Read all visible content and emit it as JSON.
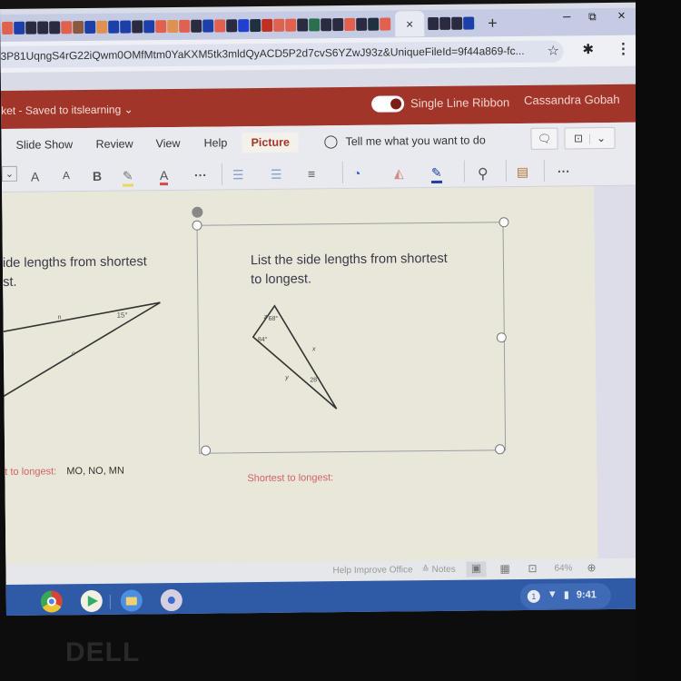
{
  "browser": {
    "tabs_overflow_count_visible": 36,
    "active_tab_close": "×",
    "new_tab": "+",
    "window_controls": {
      "minimize": "–",
      "restore": "⧉",
      "close": "×"
    },
    "address": "3P81UqngS4rG22iQwm0OMfMtm0YaKXM5tk3mldQyACD5P2d7cvS6YZwJ93z&UniqueFileId=9f44a869-fc...",
    "bookmark_icon": "☆",
    "extensions_icon": "✱",
    "menu_icon": "⋮"
  },
  "app": {
    "doc_title": "ket - Saved to itslearning ⌄",
    "single_line_ribbon": "Single Line Ribbon",
    "single_line_ribbon_on": true,
    "user": "Cassandra Gobah",
    "accent": "#a1352a"
  },
  "ribbon": {
    "tabs": [
      {
        "label": "Slide Show",
        "active": false
      },
      {
        "label": "Review",
        "active": false
      },
      {
        "label": "View",
        "active": false
      },
      {
        "label": "Help",
        "active": false
      },
      {
        "label": "Picture",
        "active": true
      }
    ],
    "tell_me": "Tell me what you want to do",
    "comments_icon": "🗨",
    "present_icon": "⊡",
    "present_dropdown": "⌄"
  },
  "toolbar": {
    "font_dropdown_chevron": "⌄",
    "grow_font": "A",
    "shrink_font": "A",
    "bold": "B",
    "highlight": "✎",
    "font_color": "A",
    "more": "···",
    "bullets": "☰",
    "numbering": "☰",
    "align": "≡",
    "shapes": "◔",
    "fill": "◭",
    "outline": "✎",
    "find": "⚲",
    "designer": "▤",
    "more2": "···"
  },
  "slide": {
    "left_question": "ide lengths from shortest\nst.",
    "left_triangle": {
      "angle": "15°",
      "side_labels": [
        "n",
        "o"
      ]
    },
    "left_answer_label": "t to longest:",
    "left_answer_value": "MO, NO, MN",
    "right_question_line1": "List the side lengths from shortest",
    "right_question_line2": "to longest.",
    "right_triangle": {
      "angles": [
        "68°",
        "84°",
        "28°"
      ],
      "side_labels": [
        "z",
        "x",
        "y"
      ]
    },
    "right_answer_label": "Shortest to longest:"
  },
  "statusbar": {
    "help": "Help Improve Office",
    "notes": "≙ Notes",
    "zoom": "64%"
  },
  "shelf": {
    "apps": [
      "Chrome",
      "Play Store",
      "Files",
      "Camera"
    ],
    "notification_count": "1",
    "time": "9:41"
  },
  "hardware": {
    "brand": "DELL"
  }
}
